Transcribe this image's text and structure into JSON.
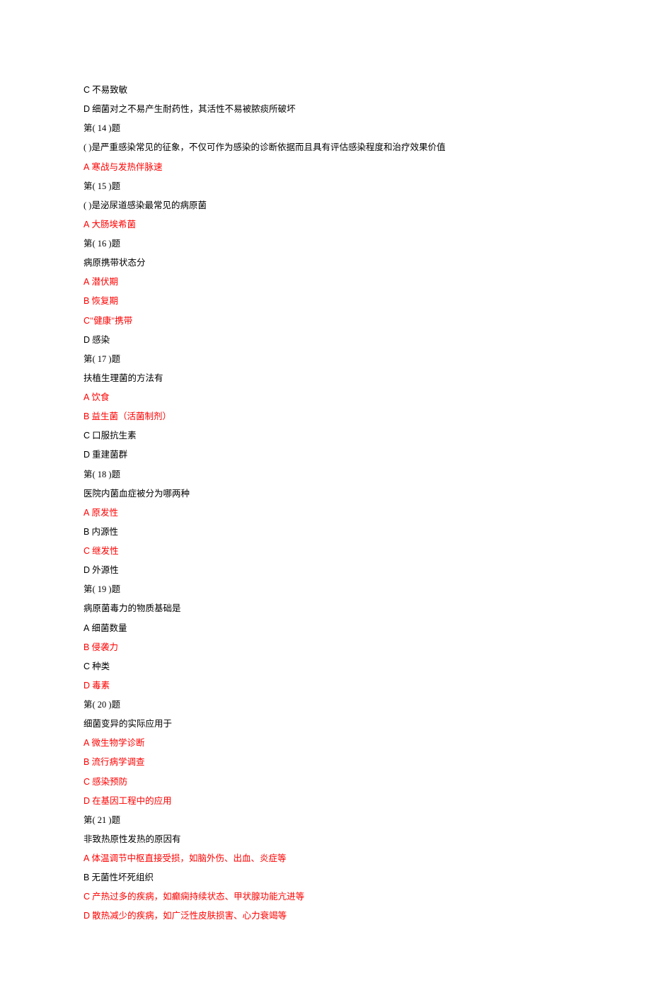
{
  "lines": [
    {
      "type": "option",
      "highlight": false,
      "letter": "C",
      "text": " 不易致敏"
    },
    {
      "type": "option",
      "highlight": false,
      "letter": "D",
      "text": " 细菌对之不易产生耐药性，其活性不易被脓痰所破坏"
    },
    {
      "type": "heading",
      "text": "第( 14 )题"
    },
    {
      "type": "stem",
      "text": "( )是严重感染常见的征象，不仅可作为感染的诊断依据而且具有评估感染程度和治疗效果价值"
    },
    {
      "type": "option",
      "highlight": true,
      "letter": "A",
      "text": " 寒战与发热伴脉速"
    },
    {
      "type": "heading",
      "text": "第( 15 )题"
    },
    {
      "type": "stem",
      "text": "( )是泌尿道感染最常见的病原菌"
    },
    {
      "type": "option",
      "highlight": true,
      "letter": "A",
      "text": " 大肠埃希菌"
    },
    {
      "type": "heading",
      "text": "第( 16 )题"
    },
    {
      "type": "stem",
      "text": "病原携带状态分"
    },
    {
      "type": "option",
      "highlight": true,
      "letter": "A",
      "text": " 潜伏期"
    },
    {
      "type": "option",
      "highlight": true,
      "letter": "B",
      "text": " 恢复期"
    },
    {
      "type": "option",
      "highlight": true,
      "letter": "C",
      "text": "\"健康\"携带"
    },
    {
      "type": "option",
      "highlight": false,
      "letter": "D",
      "text": " 感染"
    },
    {
      "type": "heading",
      "text": "第( 17 )题"
    },
    {
      "type": "stem",
      "text": "扶植生理菌的方法有"
    },
    {
      "type": "option",
      "highlight": true,
      "letter": "A",
      "text": " 饮食"
    },
    {
      "type": "option",
      "highlight": true,
      "letter": "B",
      "text": " 益生菌（活菌制剂）"
    },
    {
      "type": "option",
      "highlight": false,
      "letter": "C",
      "text": " 口服抗生素"
    },
    {
      "type": "option",
      "highlight": false,
      "letter": "D",
      "text": " 重建菌群"
    },
    {
      "type": "heading",
      "text": "第( 18 )题"
    },
    {
      "type": "stem",
      "text": "医院内菌血症被分为哪两种"
    },
    {
      "type": "option",
      "highlight": true,
      "letter": "A",
      "text": " 原发性"
    },
    {
      "type": "option",
      "highlight": false,
      "letter": "B",
      "text": " 内源性"
    },
    {
      "type": "option",
      "highlight": true,
      "letter": "C",
      "text": " 继发性"
    },
    {
      "type": "option",
      "highlight": false,
      "letter": "D",
      "text": " 外源性"
    },
    {
      "type": "heading",
      "text": "第( 19 )题"
    },
    {
      "type": "stem",
      "text": "病原菌毒力的物质基础是"
    },
    {
      "type": "option",
      "highlight": false,
      "letter": "A",
      "text": " 细菌数量"
    },
    {
      "type": "option",
      "highlight": true,
      "letter": "B",
      "text": " 侵袭力"
    },
    {
      "type": "option",
      "highlight": false,
      "letter": "C",
      "text": " 种类"
    },
    {
      "type": "option",
      "highlight": true,
      "letter": "D",
      "text": " 毒素"
    },
    {
      "type": "heading",
      "text": "第( 20 )题"
    },
    {
      "type": "stem",
      "text": "细菌变异的实际应用于"
    },
    {
      "type": "option",
      "highlight": true,
      "letter": "A",
      "text": " 微生物学诊断"
    },
    {
      "type": "option",
      "highlight": true,
      "letter": "B",
      "text": " 流行病学调查"
    },
    {
      "type": "option",
      "highlight": true,
      "letter": "C",
      "text": " 感染预防"
    },
    {
      "type": "option",
      "highlight": true,
      "letter": "D",
      "text": " 在基因工程中的应用"
    },
    {
      "type": "heading",
      "text": "第( 21 )题"
    },
    {
      "type": "stem",
      "text": "非致热原性发热的原因有"
    },
    {
      "type": "option",
      "highlight": true,
      "letter": "A",
      "text": " 体温调节中枢直接受损，如脑外伤、出血、炎症等"
    },
    {
      "type": "option",
      "highlight": false,
      "letter": "B",
      "text": " 无菌性坏死组织"
    },
    {
      "type": "option",
      "highlight": true,
      "letter": "C",
      "text": " 产热过多的疾病，如癫痫持续状态、甲状腺功能亢进等"
    },
    {
      "type": "option",
      "highlight": true,
      "letter": "D",
      "text": " 散热减少的疾病，如广泛性皮肤损害、心力衰竭等"
    }
  ]
}
